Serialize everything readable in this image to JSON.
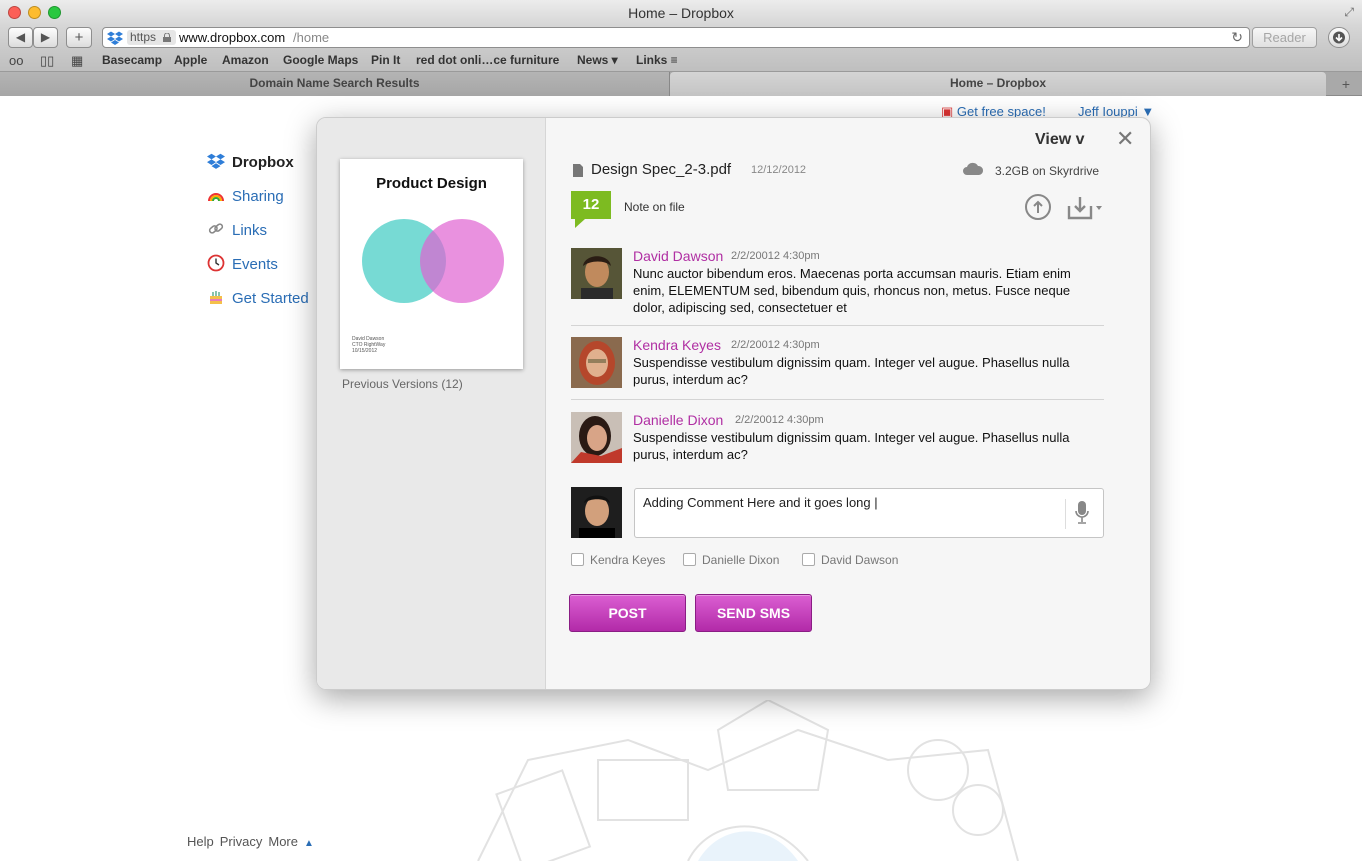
{
  "window": {
    "title": "Home – Dropbox"
  },
  "toolbar": {
    "url_scheme": "https",
    "url_host": "www.dropbox.com",
    "url_path": "/home",
    "reader_label": "Reader"
  },
  "bookmarks": [
    "Basecamp",
    "Apple",
    "Amazon",
    "Google Maps",
    "Pin It",
    "red dot onli…ce furniture",
    "News ▾",
    "Links ≡"
  ],
  "tabs": [
    "Domain Name Search Results",
    "Home – Dropbox"
  ],
  "sidebar": {
    "items": [
      {
        "label": "Dropbox",
        "icon": "dropbox-icon"
      },
      {
        "label": "Sharing",
        "icon": "rainbow-icon"
      },
      {
        "label": "Links",
        "icon": "link-icon"
      },
      {
        "label": "Events",
        "icon": "clock-icon"
      },
      {
        "label": "Get Started",
        "icon": "cake-icon"
      }
    ]
  },
  "header": {
    "free_space": "Get free space!",
    "user": "Jeff Iouppi ▼"
  },
  "footer": {
    "help": "Help",
    "privacy": "Privacy",
    "more": "More"
  },
  "modal": {
    "view_label": "View v",
    "doc": {
      "title": "Product Design",
      "meta_lines": [
        "David Dawson",
        "CTO RightWay",
        "10/15/2012"
      ]
    },
    "previous_versions": "Previous Versions (12)",
    "file_name": "Design Spec_2-3.pdf",
    "file_date": "12/12/2012",
    "storage": "3.2GB on Skyrdrive",
    "note_count": "12",
    "note_label": "Note on file",
    "comments": [
      {
        "name": "David Dawson",
        "time": "2/2/20012 4:30pm",
        "text": "Nunc auctor bibendum eros. Maecenas porta accumsan mauris. Etiam enim enim, ELEMENTUM sed, bibendum quis, rhoncus non, metus. Fusce neque dolor, adipiscing sed, consectetuer et"
      },
      {
        "name": "Kendra Keyes",
        "time": "2/2/20012 4:30pm",
        "text": "Suspendisse vestibulum dignissim quam. Integer vel augue. Phasellus nulla purus, interdum ac?"
      },
      {
        "name": "Danielle Dixon",
        "time": "2/2/20012 4:30pm",
        "text": "Suspendisse vestibulum dignissim quam. Integer vel augue. Phasellus nulla purus, interdum ac?"
      }
    ],
    "input_value": "Adding Comment Here and it goes long |",
    "recipients": [
      "Kendra Keyes",
      "Danielle Dixon",
      "David Dawson"
    ],
    "post_label": "POST",
    "sms_label": "SEND SMS"
  },
  "colors": {
    "accent": "#b02fa3",
    "note_badge": "#7dbb21",
    "link": "#2a6db5"
  }
}
